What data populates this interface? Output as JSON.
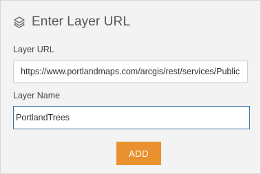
{
  "header": {
    "title": "Enter Layer URL",
    "icon": "layers-icon"
  },
  "form": {
    "url_label": "Layer URL",
    "url_value": "https://www.portlandmaps.com/arcgis/rest/services/Public",
    "name_label": "Layer Name",
    "name_value": "PortlandTrees"
  },
  "actions": {
    "add_label": "ADD"
  },
  "colors": {
    "accent": "#e8912e",
    "focus_border": "#2f6ea5",
    "panel_bg": "#f3f3f3"
  }
}
